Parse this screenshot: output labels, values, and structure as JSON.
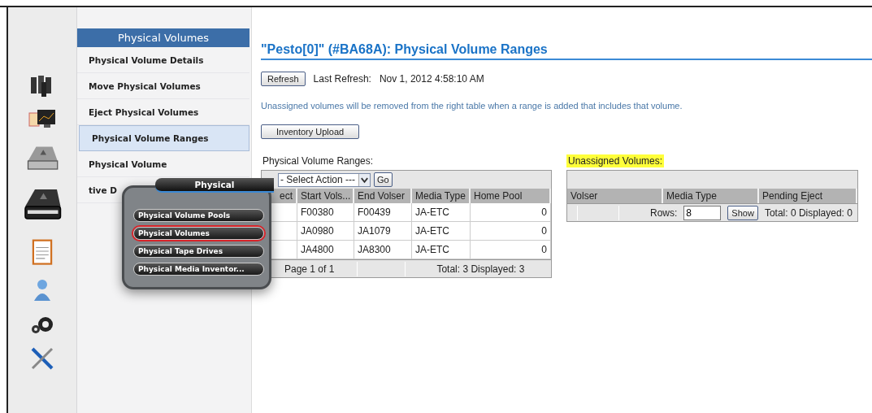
{
  "sidebar": {
    "header": "Physical Volumes",
    "items": [
      {
        "label": "Physical Volume Details",
        "selected": false
      },
      {
        "label": "Move Physical Volumes",
        "selected": false
      },
      {
        "label": "Eject Physical Volumes",
        "selected": false
      },
      {
        "label": "Physical Volume Ranges",
        "selected": true
      },
      {
        "label": "Physical Volume",
        "selected": false
      },
      {
        "label": "tive D",
        "selected": false
      }
    ]
  },
  "popup": {
    "title": "Physical",
    "items": [
      {
        "label": "Physical Volume Pools",
        "selected": false
      },
      {
        "label": "Physical Volumes",
        "selected": true
      },
      {
        "label": "Physical Tape Drives",
        "selected": false
      },
      {
        "label": "Physical Media Inventor...",
        "selected": false
      }
    ]
  },
  "page": {
    "title": "\"Pesto[0]\" (#BA68A): Physical Volume Ranges",
    "refresh_button": "Refresh",
    "last_refresh_label": "Last Refresh:",
    "last_refresh_value": "Nov 1, 2012 4:58:10 AM",
    "note": "Unassigned volumes will be removed from the right table when a range is added that includes that volume.",
    "upload_button": "Inventory Upload",
    "ranges": {
      "label": "Physical Volume Ranges:",
      "action_select": "- Select Action ---",
      "go_button": "Go",
      "columns": [
        "ect",
        "Start Vols...",
        "End Volser",
        "Media Type",
        "Home Pool"
      ],
      "rows": [
        [
          "",
          "F00380",
          "F00439",
          "JA-ETC",
          "0"
        ],
        [
          "",
          "JA0980",
          "JA1079",
          "JA-ETC",
          "0"
        ],
        [
          "",
          "JA4800",
          "JA8300",
          "JA-ETC",
          "0"
        ]
      ],
      "pager": "Page 1 of 1",
      "summary": "Total: 3   Displayed: 3"
    },
    "unassigned": {
      "label": "Unassigned Volumes:",
      "highlighted": true,
      "columns": [
        "Volser",
        "Media Type",
        "Pending Eject"
      ],
      "rows_label": "Rows:",
      "rows_value": "8",
      "show_button": "Show",
      "summary": "Total: 0   Displayed: 0"
    }
  }
}
